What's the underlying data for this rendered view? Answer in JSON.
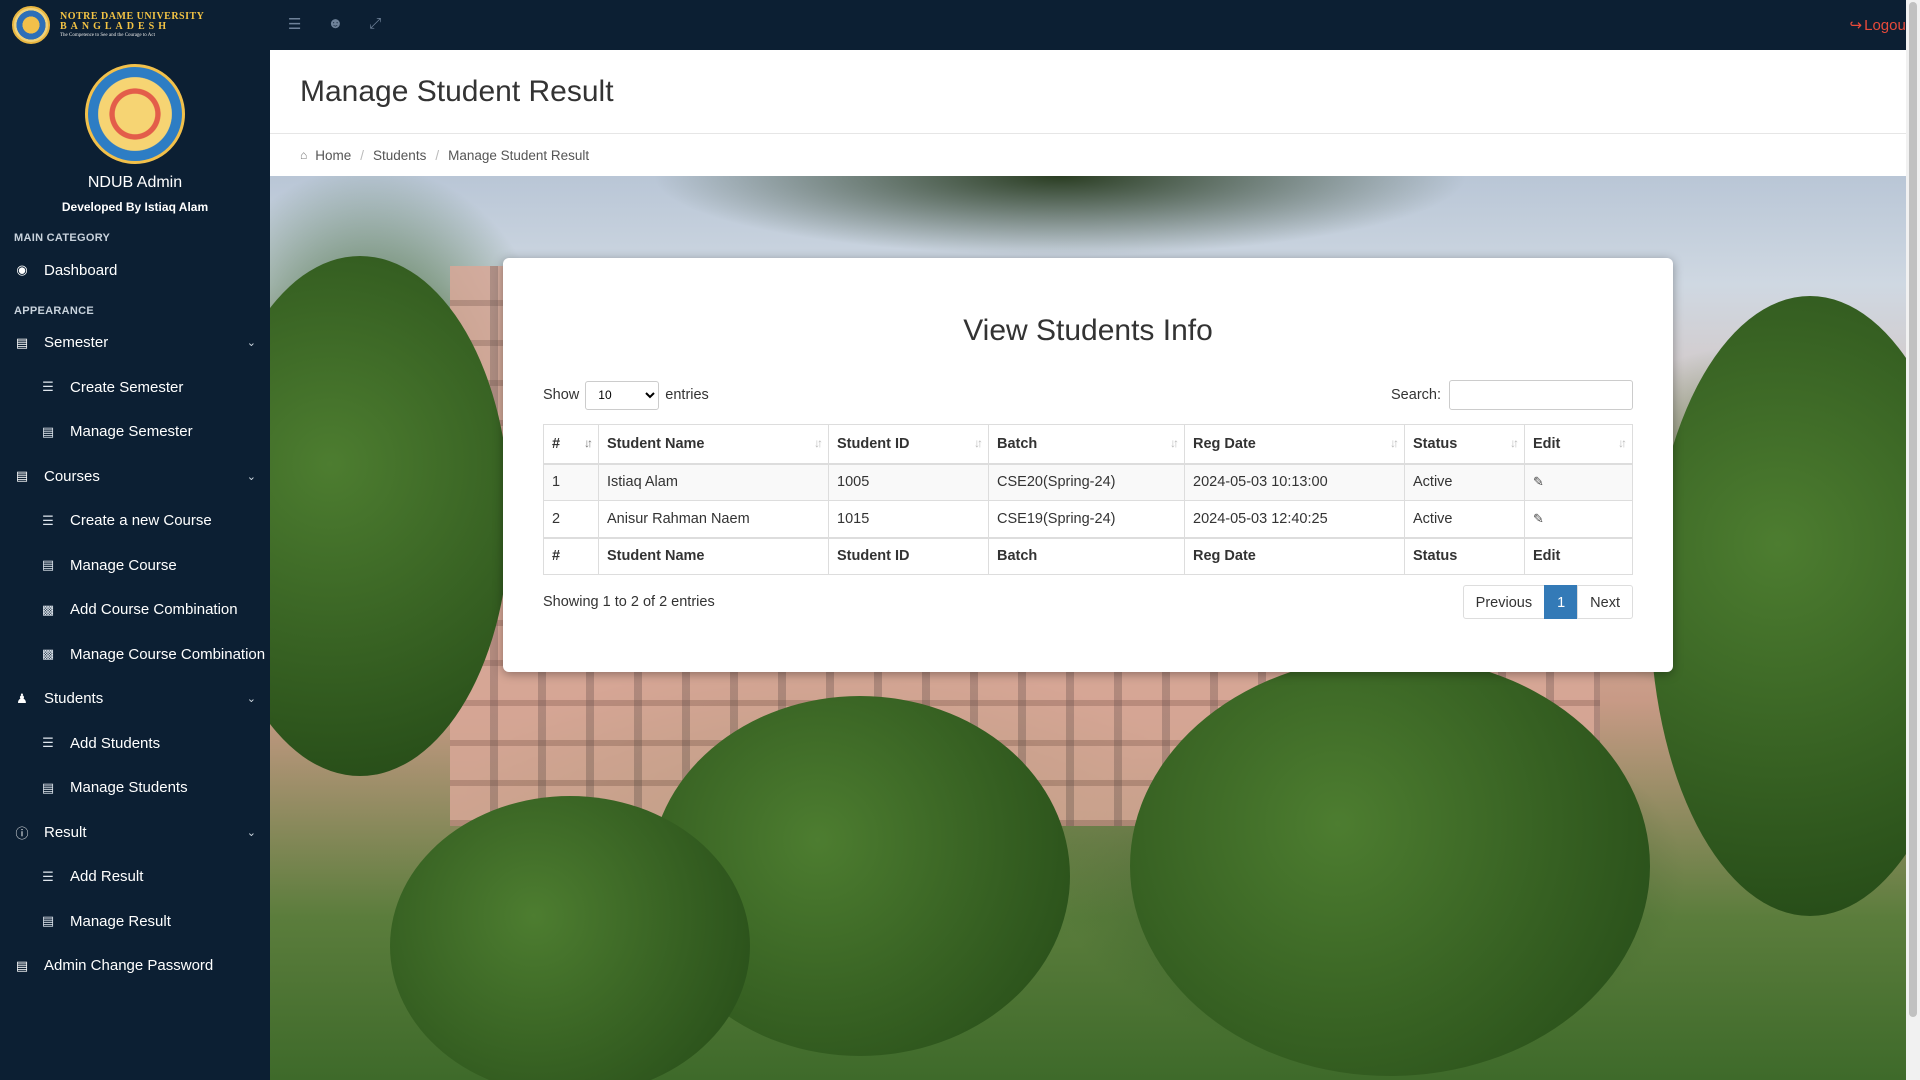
{
  "brand": {
    "line1": "NOTRE DAME UNIVERSITY",
    "line2": "BANGLADESH",
    "tagline": "The Competence to See and the Courage to Act"
  },
  "topbar": {
    "icons": [
      "list-icon",
      "user-icon",
      "expand-icon"
    ],
    "logout_label": "Logout",
    "accent_color": "#e84a3a"
  },
  "sidebar": {
    "admin_name": "NDUB Admin",
    "developer": "Developed By Istiaq Alam",
    "section_main": "MAIN CATEGORY",
    "section_appearance": "APPEARANCE",
    "dashboard": "Dashboard",
    "semester": {
      "label": "Semester",
      "create": "Create Semester",
      "manage": "Manage Semester"
    },
    "courses": {
      "label": "Courses",
      "create": "Create a new Course",
      "manage": "Manage Course",
      "add_combination": "Add Course Combination",
      "manage_combination": "Manage Course Combination"
    },
    "students": {
      "label": "Students",
      "add": "Add Students",
      "manage": "Manage Students"
    },
    "result": {
      "label": "Result",
      "add": "Add Result",
      "manage": "Manage Result"
    },
    "change_password": "Admin Change Password"
  },
  "header": {
    "title": "Manage Student Result",
    "breadcrumb": [
      "Home",
      "Students",
      "Manage Student Result"
    ]
  },
  "card": {
    "title": "View Students Info",
    "show_label": "Show",
    "entries_label": "entries",
    "page_length": "10",
    "search_label": "Search:",
    "search_value": "",
    "columns": [
      "#",
      "Student Name",
      "Student ID",
      "Batch",
      "Reg Date",
      "Status",
      "Edit"
    ],
    "rows": [
      [
        "1",
        "Istiaq Alam",
        "1005",
        "CSE20(Spring-24)",
        "2024-05-03 10:13:00",
        "Active"
      ],
      [
        "2",
        "Anisur Rahman Naem",
        "1015",
        "CSE19(Spring-24)",
        "2024-05-03 12:40:25",
        "Active"
      ]
    ],
    "info": "Showing 1 to 2 of 2 entries",
    "pager": {
      "previous": "Previous",
      "current": "1",
      "next": "Next"
    },
    "pager_color": "#337ab7"
  }
}
